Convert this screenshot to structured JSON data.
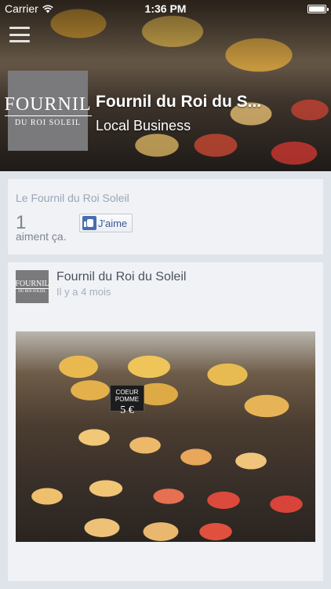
{
  "status_bar": {
    "carrier": "Carrier",
    "time": "1:36 PM"
  },
  "header": {
    "logo_main": "FOURNIL",
    "logo_sub": "DU ROI SOLEIL",
    "page_name": "Fournil du Roi du S...",
    "category": "Local Business"
  },
  "like_box": {
    "title": "Le Fournil du Roi Soleil",
    "count": "1",
    "count_label": "aiment ça.",
    "button_label": "J'aime"
  },
  "post": {
    "author": "Fournil du Roi du Soleil",
    "time": "Il y a 4 mois",
    "avatar_main": "FOURNIL",
    "avatar_sub": "DU ROI SOLEIL",
    "price_tag_name": "COEUR POMME",
    "price_tag_value": "5 €"
  }
}
